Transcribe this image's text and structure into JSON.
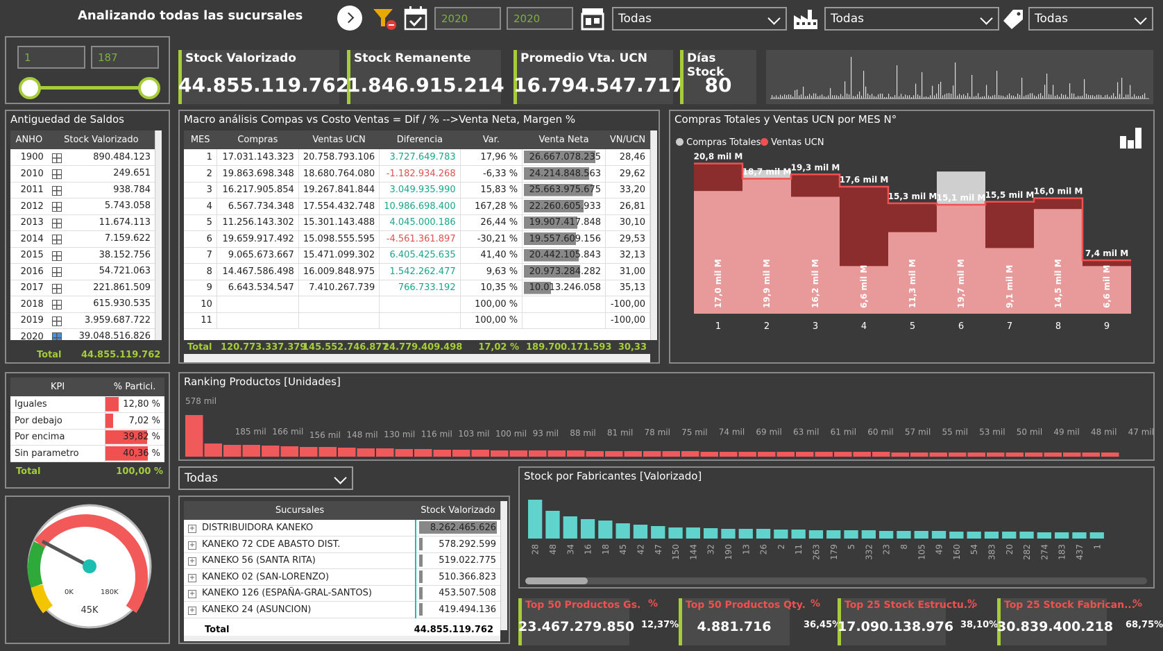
{
  "header": {
    "title": "Analizando todas las sucursales",
    "year_from": "2020",
    "year_to": "2020",
    "dd1": "Todas",
    "dd2": "Todas",
    "dd3": "Todas"
  },
  "range": {
    "min": "1",
    "max": "187"
  },
  "cards": [
    {
      "label": "Stock Valorizado",
      "value": "44.855.119.762"
    },
    {
      "label": "Stock Remanente",
      "value": "1.846.915.214"
    },
    {
      "label": "Promedio Vta. UCN",
      "value": "16.794.547.717"
    },
    {
      "label": "Días Stock",
      "value": "80"
    }
  ],
  "antiguedad": {
    "title": "Antiguedad de Saldos",
    "col1": "ANHO",
    "col2": "Stock Valorizado",
    "rows": [
      [
        "1900",
        "890.484.123"
      ],
      [
        "2010",
        "249.651"
      ],
      [
        "2011",
        "938.784"
      ],
      [
        "2012",
        "5.743.058"
      ],
      [
        "2013",
        "11.674.113"
      ],
      [
        "2014",
        "7.159.622"
      ],
      [
        "2015",
        "38.152.756"
      ],
      [
        "2016",
        "54.721.063"
      ],
      [
        "2017",
        "221.861.509"
      ],
      [
        "2018",
        "615.930.535"
      ],
      [
        "2019",
        "3.959.687.722"
      ],
      [
        "2020",
        "39.048.516.826"
      ]
    ],
    "total_label": "Total",
    "total_value": "44.855.119.762"
  },
  "macro": {
    "title": "Macro análisis Compas vs Costo Ventas = Dif / % -->Venta Neta, Margen %",
    "cols": [
      "MES",
      "Compras",
      "Ventas UCN",
      "Diferencia",
      "Var.",
      "Venta Neta",
      "VN/UCN"
    ],
    "rows": [
      [
        "1",
        "17.031.143.323",
        "20.758.793.106",
        "3.727.649.783",
        "17,96 %",
        "26.667.078.235",
        "28,46"
      ],
      [
        "2",
        "19.863.698.348",
        "18.680.764.080",
        "-1.182.934.268",
        "-6,33 %",
        "24.214.848.563",
        "29,62"
      ],
      [
        "3",
        "16.217.905.854",
        "19.267.841.844",
        "3.049.935.990",
        "15,83 %",
        "25.663.975.675",
        "33,20"
      ],
      [
        "4",
        "6.567.734.348",
        "17.554.432.748",
        "10.986.698.400",
        "167,28 %",
        "22.260.605.933",
        "26,81"
      ],
      [
        "5",
        "11.256.143.302",
        "15.301.143.488",
        "4.045.000.186",
        "26,44 %",
        "19.907.417.848",
        "30,10"
      ],
      [
        "6",
        "19.659.917.492",
        "15.098.555.595",
        "-4.561.361.897",
        "-30,21 %",
        "19.557.609.156",
        "29,53"
      ],
      [
        "7",
        "9.065.673.667",
        "15.471.099.302",
        "6.405.425.635",
        "41,40 %",
        "20.442.105.843",
        "32,13"
      ],
      [
        "8",
        "14.467.586.498",
        "16.009.848.975",
        "1.542.262.477",
        "9,63 %",
        "20.973.284.282",
        "31,00"
      ],
      [
        "9",
        "6.643.534.547",
        "7.410.267.739",
        "766.733.192",
        "10,35 %",
        "10.013.246.058",
        "35,13"
      ],
      [
        "10",
        "",
        "",
        "",
        "100,00 %",
        "",
        "-100,00"
      ],
      [
        "11",
        "",
        "",
        "",
        "100,00 %",
        "",
        "-100,00"
      ]
    ],
    "bars": [
      0.79,
      0.72,
      0.76,
      0.66,
      0.59,
      0.58,
      0.61,
      0.62,
      0.3,
      0,
      0
    ],
    "total": [
      "Total",
      "120.773.337.379",
      "145.552.746.877",
      "24.779.409.498",
      "17,02 %",
      "189.700.171.593",
      "30,33"
    ]
  },
  "monthly": {
    "title": "Compras Totales y Ventas UCN por MES N°",
    "legend1": "Compras Totales",
    "legend2": "Ventas UCN",
    "months": [
      "1",
      "2",
      "3",
      "4",
      "5",
      "6",
      "7",
      "8",
      "9"
    ],
    "compras": [
      17.0,
      19.9,
      16.2,
      6.6,
      11.3,
      19.7,
      9.1,
      14.5,
      6.6
    ],
    "compras_labels": [
      "17,0 mil M",
      "19,9 mil M",
      "16,2 mil M",
      "6,6 mil M",
      "11,3 mil M",
      "19,7 mil M",
      "9,1 mil M",
      "14,5 mil M",
      "6,6 mil M"
    ],
    "ventas": [
      20.8,
      18.7,
      19.3,
      17.6,
      15.3,
      15.1,
      15.5,
      16.0,
      7.4
    ],
    "ventas_labels": [
      "20,8 mil M",
      "18,7 mil M",
      "19,3 mil M",
      "17,6 mil M",
      "15,3 mil M",
      "15,1 mil M",
      "15,5 mil M",
      "16,0 mil M",
      "7,4 mil M"
    ]
  },
  "kpi": {
    "col1": "KPI",
    "col2": "% Partici.",
    "rows": [
      [
        "Iguales",
        "12,80 %",
        0.128
      ],
      [
        "Por debajo",
        "7,02 %",
        0.07
      ],
      [
        "Por encima",
        "39,82 %",
        0.398
      ],
      [
        "Sin parametro",
        "40,36 %",
        0.404
      ]
    ],
    "total_label": "Total",
    "total_value": "100,00 %"
  },
  "ranking": {
    "title": "Ranking Productos [Unidades]",
    "labels": [
      "578 mil",
      "185 mil",
      "166 mil",
      "156 mil",
      "148 mil",
      "130 mil",
      "116 mil",
      "103 mil",
      "100 mil",
      "93 mil",
      "88 mil",
      "81 mil",
      "78 mil",
      "75 mil",
      "74 mil",
      "69 mil",
      "63 mil",
      "61 mil",
      "60 mil",
      "57 mil",
      "55 mil",
      "53 mil",
      "50 mil",
      "49 mil",
      "48 mil",
      "47 mil"
    ]
  },
  "gauge": {
    "min": "0K",
    "max": "180K",
    "value": "45K"
  },
  "sucursal_dd": "Todas",
  "sucursales": {
    "col1": "Sucursales",
    "col2": "Stock Valorizado",
    "rows": [
      [
        "DISTRIBUIDORA KANEKO",
        "8.262.465.626"
      ],
      [
        "KANEKO 72 CDE ABASTO DIST.",
        "578.292.599"
      ],
      [
        "KANEKO 56 (SANTA RITA)",
        "519.022.775"
      ],
      [
        "KANEKO 02 (SAN-LORENZO)",
        "510.366.823"
      ],
      [
        "KANEKO 126 (ESPAÑA-GRAL-SANTOS)",
        "453.507.508"
      ],
      [
        "KANEKO 24 (ASUNCION)",
        "419.494.136"
      ]
    ],
    "total_label": "Total",
    "total_value": "44.855.119.762"
  },
  "fabricantes": {
    "title": "Stock por Fabricantes [Valorizado]",
    "labels": [
      "28",
      "48",
      "34",
      "16",
      "18",
      "45",
      "42",
      "47",
      "150",
      "144",
      "32",
      "190",
      "13",
      "26",
      "2",
      "11",
      "263",
      "179",
      "5",
      "332",
      "23",
      "8",
      "105",
      "49",
      "160",
      "54",
      "383",
      "20",
      "282",
      "274",
      "183",
      "437",
      "1"
    ]
  },
  "bottom": [
    {
      "label": "Top 50 Productos Gs.",
      "value": "23.467.279.850",
      "pct": "12,37%"
    },
    {
      "label": "Top 50 Productos Qty.",
      "value": "4.881.716",
      "pct": "36,45%"
    },
    {
      "label": "Top 25 Stock Estructu...",
      "value": "17.090.138.976",
      "pct": "38,10%"
    },
    {
      "label": "Top 25 Stock Fabrican...",
      "value": "30.839.400.218",
      "pct": "68,75%"
    }
  ],
  "pct_symbol": "%"
}
